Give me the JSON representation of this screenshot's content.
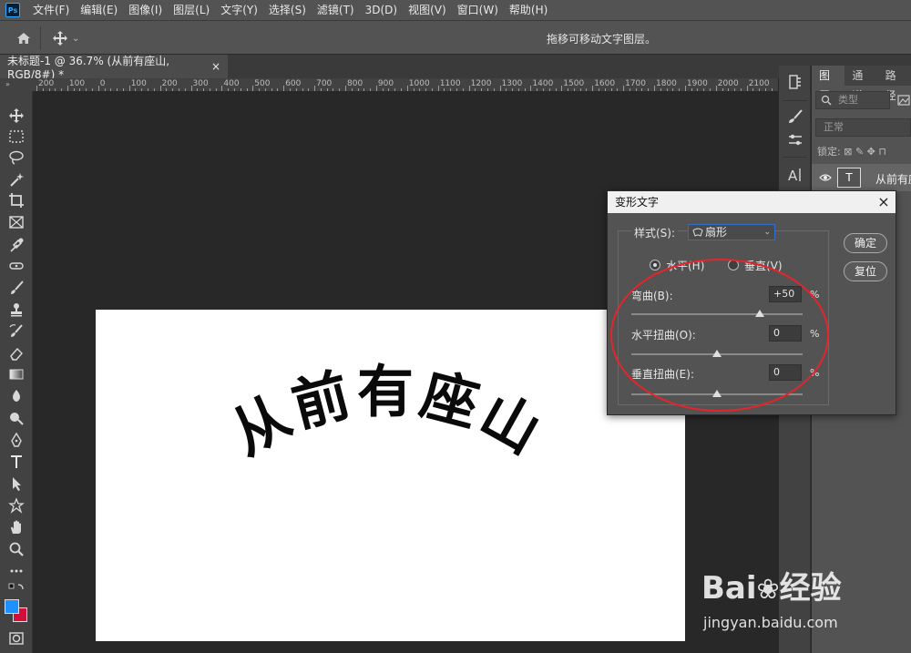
{
  "app": {
    "logo": "Ps"
  },
  "menu": [
    "文件(F)",
    "编辑(E)",
    "图像(I)",
    "图层(L)",
    "文字(Y)",
    "选择(S)",
    "滤镜(T)",
    "3D(D)",
    "视图(V)",
    "窗口(W)",
    "帮助(H)"
  ],
  "options_bar": {
    "hint": "拖移可移动文字图层。"
  },
  "document_tab": {
    "title": "未标题-1 @ 36.7% (从前有座山, RGB/8#) *",
    "close": "×"
  },
  "ruler": {
    "ticks": [
      "200",
      "100",
      "0",
      "100",
      "200",
      "300",
      "400",
      "500",
      "600",
      "700",
      "800",
      "900",
      "1000",
      "1100",
      "1200",
      "1300",
      "1400",
      "1500",
      "1600",
      "1700",
      "1800",
      "1900",
      "2000",
      "2100"
    ]
  },
  "canvas": {
    "text": "从前有座山"
  },
  "layers_panel": {
    "tabs": [
      "图层",
      "通道",
      "路径"
    ],
    "filter_placeholder": "类型",
    "blend_mode": "正常",
    "lock_label": "锁定:",
    "layer_name": "从前有座山",
    "layer_thumb": "T"
  },
  "dialog": {
    "title": "变形文字",
    "close": "×",
    "style_label": "样式(S):",
    "style_value": "扇形",
    "orientation": {
      "horizontal": "水平(H)",
      "vertical": "垂直(V)",
      "selected": "horizontal"
    },
    "bend": {
      "label": "弯曲(B):",
      "value": "+50",
      "unit": "%",
      "level": 50
    },
    "h_distort": {
      "label": "水平扭曲(O):",
      "value": "0",
      "unit": "%",
      "level": 0
    },
    "v_distort": {
      "label": "垂直扭曲(E):",
      "value": "0",
      "unit": "%",
      "level": 0
    },
    "ok": "确定",
    "reset": "复位"
  },
  "watermark": {
    "brand": "Bai",
    "brand2": "经验",
    "url": "jingyan.baidu.com"
  },
  "colors": {
    "accent_red": "#e4252c",
    "foreground": "#1e90ff",
    "background": "#d0103a"
  }
}
